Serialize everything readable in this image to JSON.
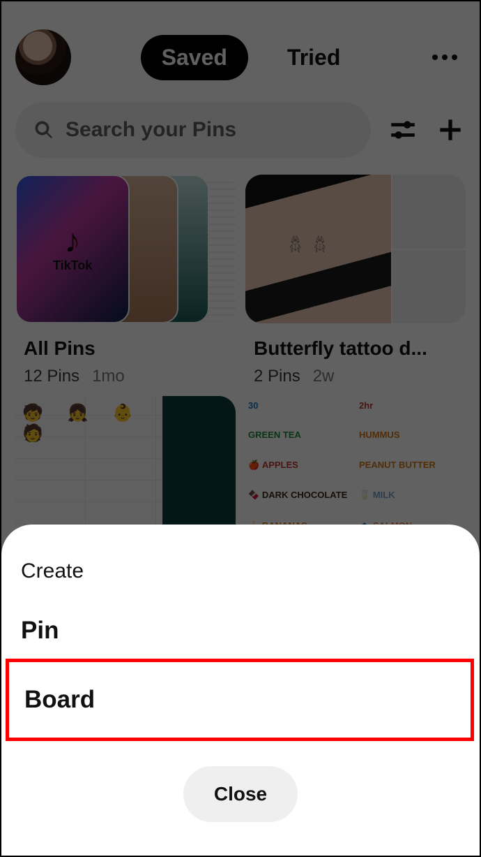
{
  "header": {
    "tabs": {
      "saved": "Saved",
      "tried": "Tried"
    }
  },
  "search": {
    "placeholder": "Search your Pins"
  },
  "boards": [
    {
      "title": "All Pins",
      "pins": "12 Pins",
      "age": "1mo"
    },
    {
      "title": "Butterfly tattoo d...",
      "pins": "2 Pins",
      "age": "2w"
    }
  ],
  "row2b": {
    "tl_hdr": "30",
    "tr_hdr": "2hr",
    "green": "GREEN TEA",
    "hummus": "HUMMUS",
    "apples": "APPLES",
    "pb": "PEANUT BUTTER",
    "choc": "DARK CHOCOLATE",
    "milk": "MILK",
    "ban": "BANANAS",
    "salmon": "SALMON"
  },
  "sheet": {
    "title": "Create",
    "pin": "Pin",
    "board": "Board",
    "close": "Close"
  }
}
